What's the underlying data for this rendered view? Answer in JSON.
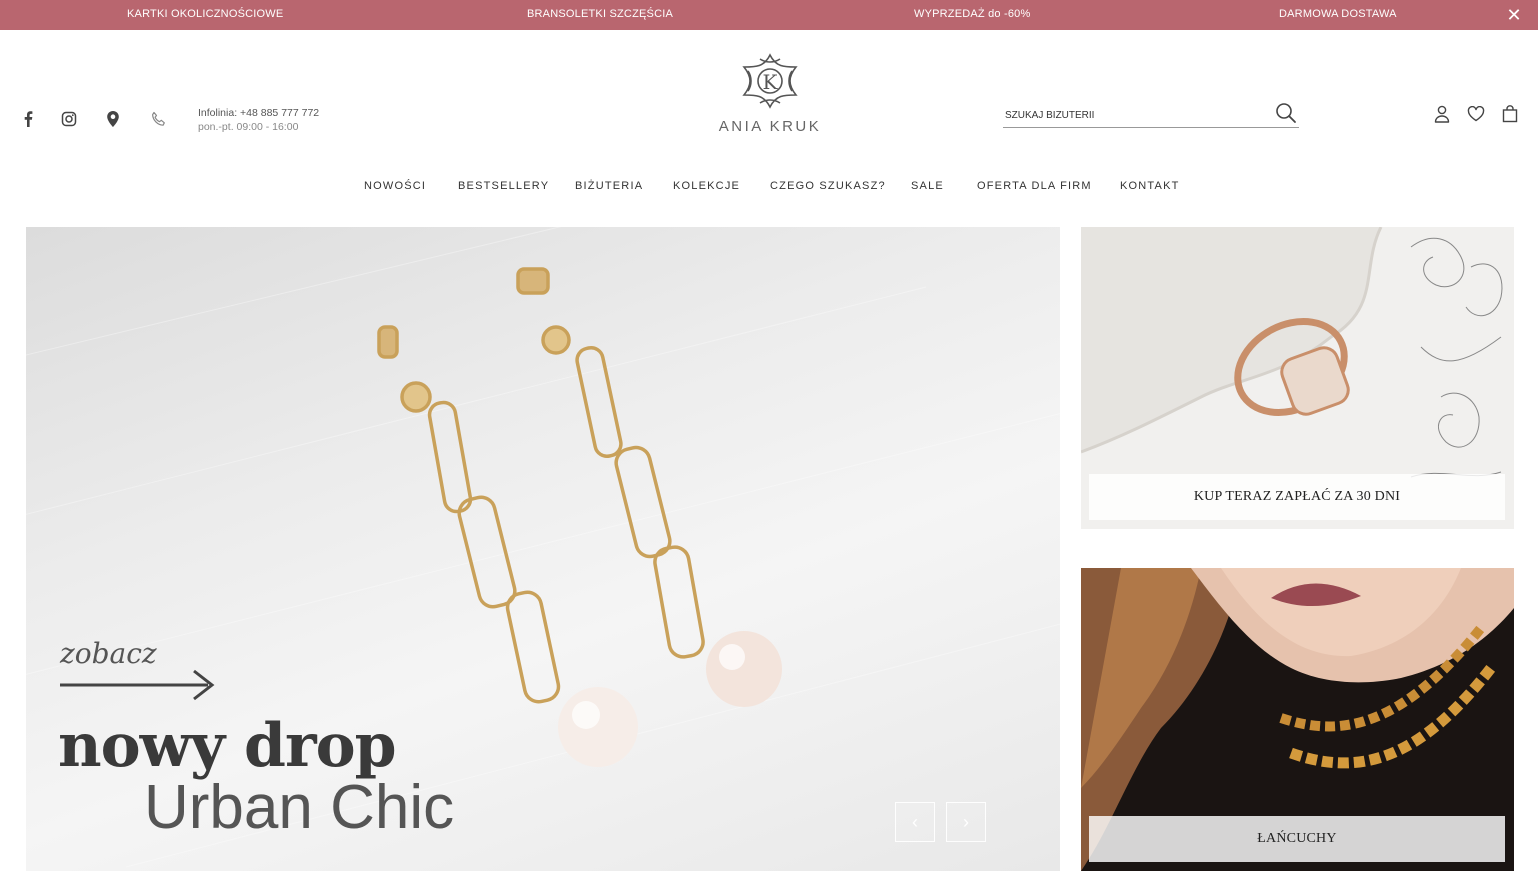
{
  "promo": {
    "items": [
      "KARTKI OKOLICZNOŚCIOWE",
      "BRANSOLETKI SZCZĘŚCIA",
      "WYPRZEDAŻ do -60%",
      "DARMOWA DOSTAWA"
    ],
    "close_glyph": "✕",
    "color": "#b9666f"
  },
  "header": {
    "social_icons": [
      "facebook-icon",
      "instagram-icon",
      "location-pin-icon",
      "phone-icon"
    ],
    "hotline": "Infolinia: +48 885 777 772",
    "hours": "pon.-pt. 09:00 - 16:00",
    "logo_letter": "K",
    "logo_text": "ANIA KRUK",
    "search_placeholder": "SZUKAJ BIŻUTERII",
    "icons": [
      "account-icon",
      "heart-icon",
      "shopping-bag-icon"
    ]
  },
  "nav": {
    "items": [
      "NOWOŚCI",
      "BESTSELLERY",
      "BIŻUTERIA",
      "KOLEKCJE",
      "CZEGO SZUKASZ?",
      "SALE",
      "OFERTA DLA FIRM",
      "KONTAKT"
    ]
  },
  "hero": {
    "zobacz": "zobacz",
    "title": "nowy drop",
    "subtitle": "Urban Chic",
    "prev_glyph": "‹",
    "next_glyph": "›"
  },
  "banners": {
    "top_label": "KUP TERAZ ZAPŁAĆ ZA 30 DNI",
    "bottom_label": "ŁAŃCUCHY"
  }
}
